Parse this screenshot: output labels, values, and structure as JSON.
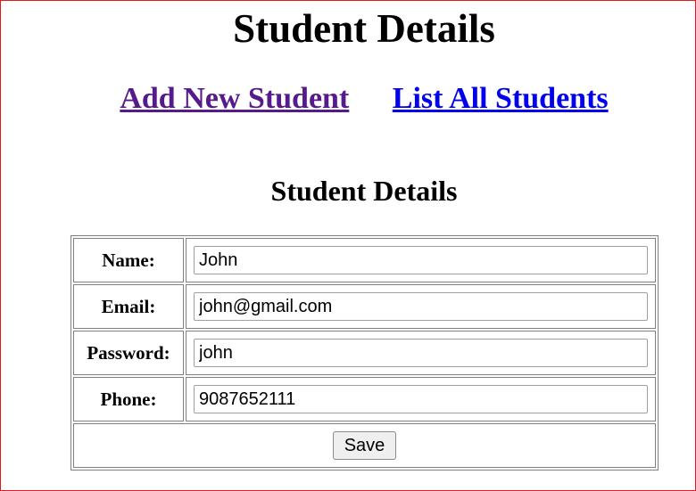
{
  "header": {
    "title": "Student Details"
  },
  "nav": {
    "add_new_label": "Add New Student",
    "list_all_label": "List All Students"
  },
  "form": {
    "title": "Student Details",
    "fields": [
      {
        "label": "Name:",
        "value": "John"
      },
      {
        "label": "Email:",
        "value": "john@gmail.com"
      },
      {
        "label": "Password:",
        "value": "john"
      },
      {
        "label": "Phone:",
        "value": "9087652111"
      }
    ],
    "save_label": "Save"
  },
  "colors": {
    "frame_border": "#e01b1b",
    "visited_link": "#551a8b",
    "link": "#0000ee"
  }
}
